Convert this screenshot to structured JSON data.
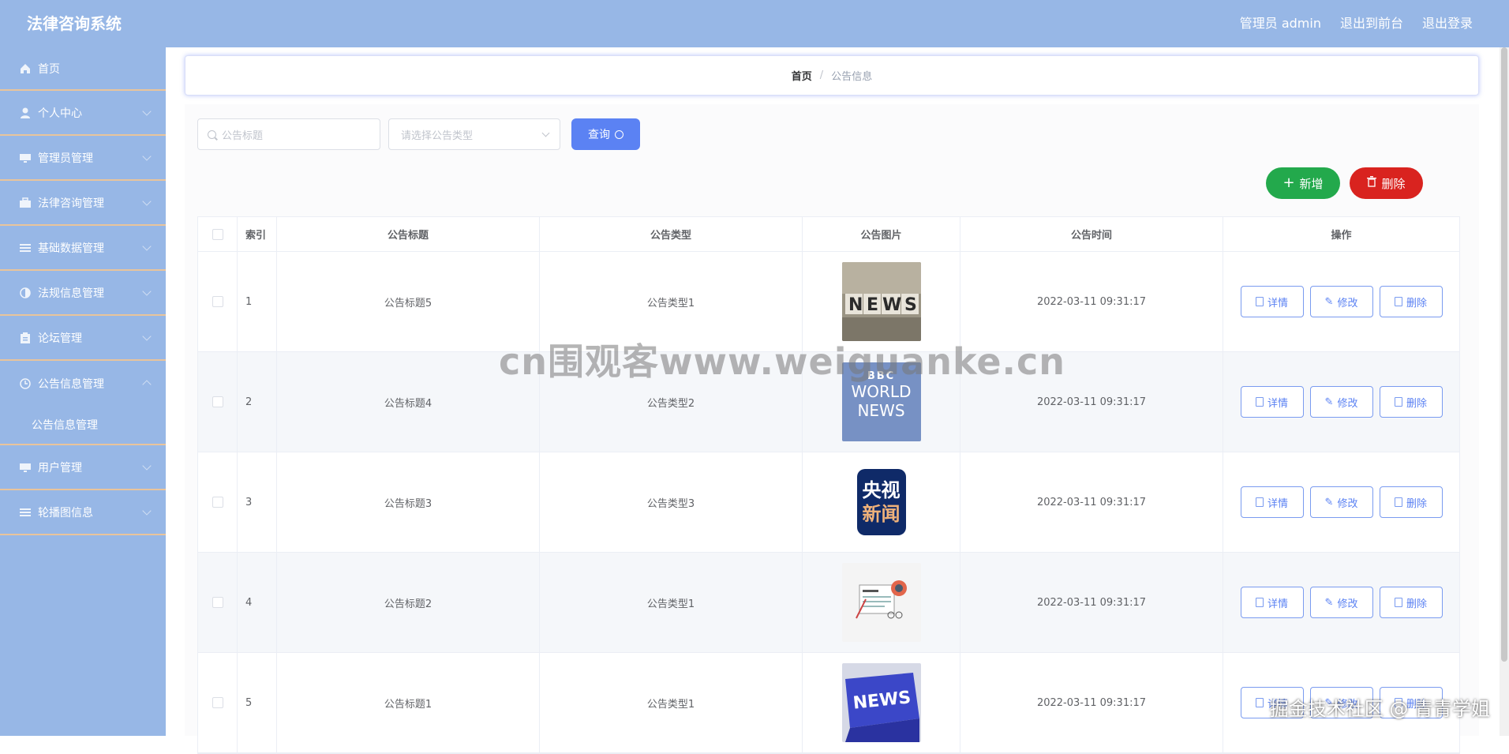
{
  "app": {
    "title": "法律咨询系统"
  },
  "header": {
    "admin": "管理员 admin",
    "to_front": "退出到前台",
    "logout": "退出登录"
  },
  "sidebar": {
    "items": [
      {
        "label": "首页",
        "icon": "home-icon"
      },
      {
        "label": "个人中心",
        "icon": "user-icon"
      },
      {
        "label": "管理员管理",
        "icon": "monitor-icon"
      },
      {
        "label": "法律咨询管理",
        "icon": "briefcase-icon"
      },
      {
        "label": "基础数据管理",
        "icon": "list-icon"
      },
      {
        "label": "法规信息管理",
        "icon": "half-circle-icon"
      },
      {
        "label": "论坛管理",
        "icon": "clipboard-icon"
      },
      {
        "label": "公告信息管理",
        "icon": "clock-icon"
      },
      {
        "label": "用户管理",
        "icon": "monitor-icon"
      },
      {
        "label": "轮播图信息",
        "icon": "list-icon"
      }
    ],
    "submenu": {
      "label": "公告信息管理"
    }
  },
  "breadcrumb": {
    "home": "首页",
    "sep": "/",
    "current": "公告信息"
  },
  "search": {
    "title_placeholder": "公告标题",
    "type_placeholder": "请选择公告类型",
    "query_label": "查询"
  },
  "actions": {
    "add_label": "新增",
    "delete_label": "删除"
  },
  "table": {
    "headers": {
      "index": "索引",
      "title": "公告标题",
      "type": "公告类型",
      "image": "公告图片",
      "time": "公告时间",
      "ops": "操作"
    },
    "op_labels": {
      "detail": "详情",
      "edit": "修改",
      "delete": "删除"
    },
    "rows": [
      {
        "index": "1",
        "title": "公告标题5",
        "type": "公告类型1",
        "time": "2022-03-11 09:31:17",
        "image": "news-blocks"
      },
      {
        "index": "2",
        "title": "公告标题4",
        "type": "公告类型2",
        "time": "2022-03-11 09:31:17",
        "image": "bbc-world-news",
        "image_text": [
          "BBC",
          "WORLD",
          "NEWS"
        ]
      },
      {
        "index": "3",
        "title": "公告标题3",
        "type": "公告类型3",
        "time": "2022-03-11 09:31:17",
        "image": "cctv-news",
        "image_text": [
          "央视",
          "新闻"
        ]
      },
      {
        "index": "4",
        "title": "公告标题2",
        "type": "公告类型1",
        "time": "2022-03-11 09:31:17",
        "image": "news-illustration"
      },
      {
        "index": "5",
        "title": "公告标题1",
        "type": "公告类型1",
        "time": "2022-03-11 09:31:17",
        "image": "news-key"
      }
    ]
  },
  "overlays": {
    "watermark": "cn围观客www.weiguanke.cn",
    "corner": "掘金技术社区 @ 青青学姐"
  },
  "colors": {
    "header_bg": "#97b7e6",
    "sidebar_bg": "#97b7e6",
    "accent": "#5b82f3",
    "add_green": "#23a94c",
    "delete_red": "#d9231f",
    "menu_divider": "#e9c49b"
  }
}
